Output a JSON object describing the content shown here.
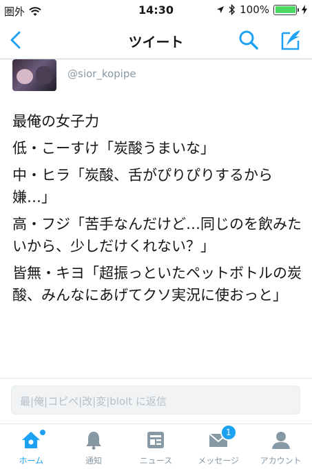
{
  "status_bar": {
    "carrier": "圏外",
    "time": "14:30",
    "battery": "100%",
    "battery_level": 1.0
  },
  "nav": {
    "title": "ツイート"
  },
  "tweet": {
    "handle": "@sior_kopipe",
    "lines": [
      "最俺の女子力",
      "低・こーすけ「炭酸うまいな」",
      "中・ヒラ「炭酸、舌がぴりぴりするから嫌…」",
      "高・フジ「苦手なんだけど…同じのを飲みたいから、少しだけくれない？」",
      "皆無・キヨ「超振っといたペットボトルの炭酸、みんなにあげてクソ実況に使おっと」"
    ]
  },
  "reply": {
    "placeholder": "最|俺|コピペ|改|変|blolt に返信"
  },
  "tabs": [
    {
      "label": "ホーム",
      "icon": "home-icon",
      "active": true
    },
    {
      "label": "通知",
      "icon": "bell-icon"
    },
    {
      "label": "ニュース",
      "icon": "news-icon"
    },
    {
      "label": "メッセージ",
      "icon": "mail-icon",
      "badge": "1"
    },
    {
      "label": "アカウント",
      "icon": "account-icon"
    }
  ],
  "colors": {
    "accent": "#1da1f2",
    "muted": "#8899a6"
  }
}
